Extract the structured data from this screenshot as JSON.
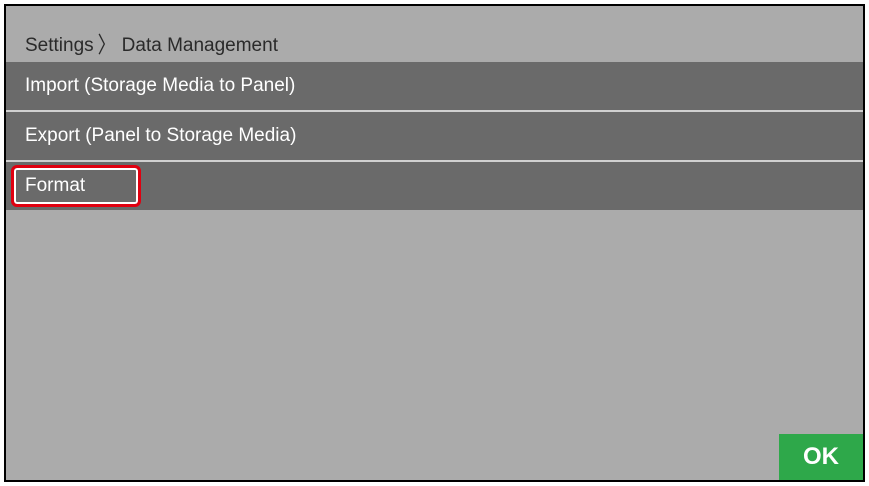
{
  "breadcrumb": {
    "parent": "Settings",
    "separator": "〉",
    "current": "Data Management"
  },
  "menu": {
    "items": [
      {
        "label": "Import (Storage Media to Panel)"
      },
      {
        "label": "Export (Panel to Storage Media)"
      },
      {
        "label": "Format",
        "highlighted": true
      }
    ]
  },
  "footer": {
    "ok_label": "OK"
  },
  "colors": {
    "background": "#ababab",
    "menu_row": "#6a6a6a",
    "highlight_border": "#e00010",
    "ok_button": "#2ea84a"
  }
}
